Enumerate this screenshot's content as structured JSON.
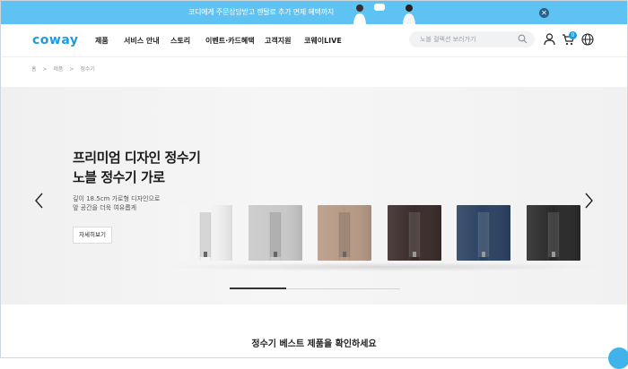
{
  "promo": {
    "text": "코디에게 주문상담받고 렌탈료 추가 면제 혜택까지"
  },
  "header": {
    "logo": "coway",
    "nav": [
      "제품",
      "서비스 안내",
      "스토리",
      "이벤트·카드혜택",
      "고객지원",
      "코웨이LIVE"
    ],
    "search_placeholder": "노블 컬렉션 보러가기",
    "cart_count": "0"
  },
  "breadcrumb": [
    "홈",
    ">",
    "제품",
    ">",
    "정수기"
  ],
  "hero": {
    "title_line1": "프리미엄 디자인 정수기",
    "title_line2": "노블 정수기 가로",
    "desc_line1": "깊이 18.5cm 가로형 디자인으로",
    "desc_line2": "앞 공간을 더욱 여유롭게",
    "button": "자세히보기",
    "slide_progress": 0.33,
    "product_colors": [
      "#f4f4f4",
      "#c9c9c9",
      "#b79a86",
      "#3a2c2a",
      "#2b4262",
      "#2a2a2a"
    ]
  },
  "section": {
    "title": "정수기 베스트 제품을 확인하세요"
  },
  "colors": {
    "accent": "#1e9be0",
    "promo_bg": "#5ec3f2"
  },
  "icons": [
    "close-icon",
    "search-icon",
    "user-icon",
    "cart-icon",
    "globe-icon",
    "arrow-left-icon",
    "arrow-right-icon",
    "chat-icon"
  ]
}
